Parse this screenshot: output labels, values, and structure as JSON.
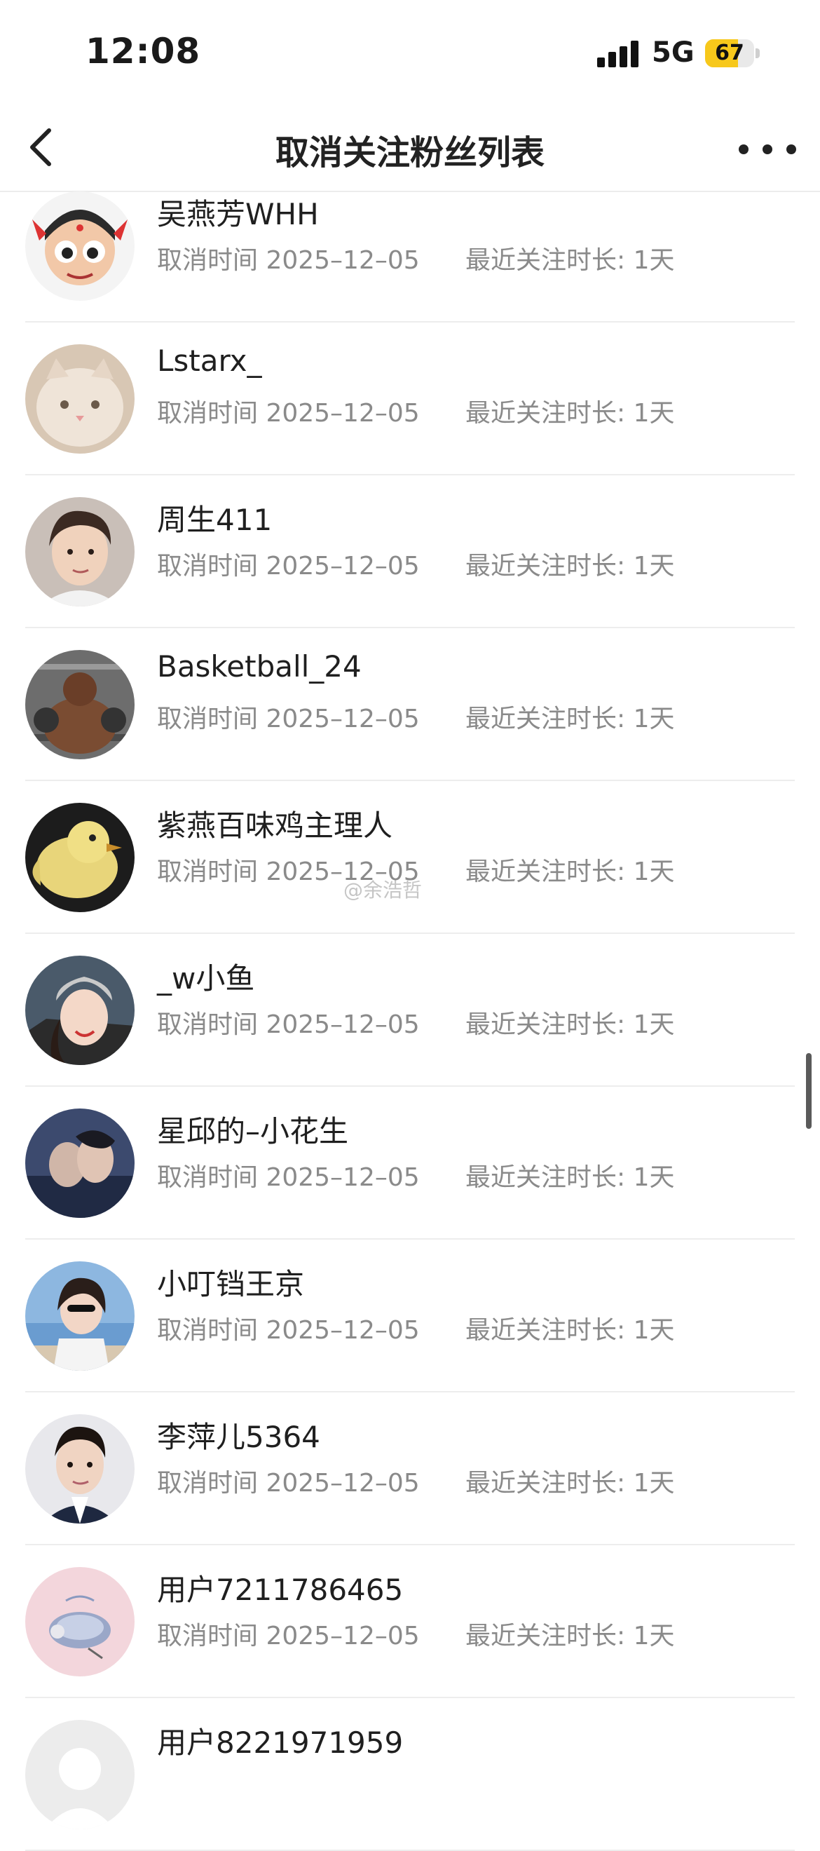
{
  "status_bar": {
    "time": "12:08",
    "network": "5G",
    "battery": "67",
    "battery_level": 0.67
  },
  "header": {
    "title": "取消关注粉丝列表",
    "back_icon": "chevron-left-icon",
    "more_icon": "more-dots-icon"
  },
  "labels": {
    "cancel_time_prefix": "取消时间",
    "duration_prefix": "最近关注时长: "
  },
  "watermark": "@余浩哲",
  "colors": {
    "battery_fill": "#f7c81b",
    "secondary_text": "#8a8a8a",
    "divider": "#ededed"
  },
  "fans": [
    {
      "name": "吴燕芳WHH",
      "time": "取消时间 2025–12–05",
      "duration": "最近关注时长: 1天"
    },
    {
      "name": "Lstarx_",
      "time": "取消时间 2025–12–05",
      "duration": "最近关注时长: 1天"
    },
    {
      "name": "周生411",
      "time": "取消时间 2025–12–05",
      "duration": "最近关注时长: 1天"
    },
    {
      "name": "Basketball_24",
      "time": "取消时间 2025–12–05",
      "duration": "最近关注时长: 1天"
    },
    {
      "name": "紫燕百味鸡主理人",
      "time": "取消时间 2025–12–05",
      "duration": "最近关注时长: 1天"
    },
    {
      "name": "_w小鱼",
      "time": "取消时间 2025–12–05",
      "duration": "最近关注时长: 1天"
    },
    {
      "name": "星邱的–小花生",
      "time": "取消时间 2025–12–05",
      "duration": "最近关注时长: 1天"
    },
    {
      "name": "小叮铛王京",
      "time": "取消时间 2025–12–05",
      "duration": "最近关注时长: 1天"
    },
    {
      "name": "李萍儿5364",
      "time": "取消时间 2025–12–05",
      "duration": "最近关注时长: 1天"
    },
    {
      "name": "用户7211786465",
      "time": "取消时间 2025–12–05",
      "duration": "最近关注时长: 1天"
    },
    {
      "name": "用户8221971959",
      "time": "",
      "duration": ""
    }
  ]
}
